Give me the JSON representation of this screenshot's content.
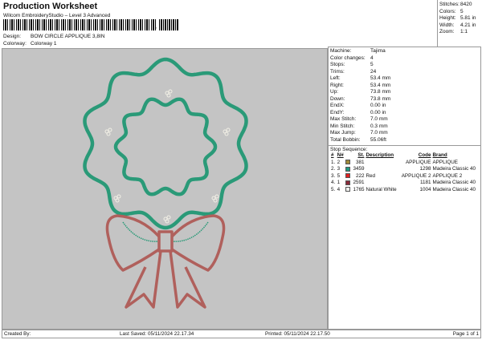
{
  "header": {
    "title": "Production Worksheet",
    "subtitle": "Wilcom EmbroideryStudio – Level 3 Advanced",
    "barcode_suffix": ",",
    "design_label": "Design:",
    "design_value": "BOW CIRCLE APPLIQUE 3,8IN",
    "colorway_label": "Colorway:",
    "colorway_value": "Colorway 1"
  },
  "summary": [
    {
      "k": "Stitches:",
      "v": "8420"
    },
    {
      "k": "Colors:",
      "v": "5"
    },
    {
      "k": "Height:",
      "v": "5.81 in"
    },
    {
      "k": "Width:",
      "v": "4.21 in"
    },
    {
      "k": "Zoom:",
      "v": "1:1"
    }
  ],
  "details": [
    {
      "k": "Machine:",
      "v": "Tajima"
    },
    {
      "k": "Color changes:",
      "v": "4"
    },
    {
      "k": "Stops:",
      "v": "5"
    },
    {
      "k": "Trims:",
      "v": "24"
    },
    {
      "k": "Left:",
      "v": "53.4 mm"
    },
    {
      "k": "Right:",
      "v": "53.4 mm"
    },
    {
      "k": "Up:",
      "v": "73.8 mm"
    },
    {
      "k": "Down:",
      "v": "73.8 mm"
    },
    {
      "k": "EndX:",
      "v": "0.00 in"
    },
    {
      "k": "EndY:",
      "v": "0.00 in"
    },
    {
      "k": "Max Stitch:",
      "v": "7.0 mm"
    },
    {
      "k": "Min Stitch:",
      "v": "0.3 mm"
    },
    {
      "k": "Max Jump:",
      "v": "7.0 mm"
    },
    {
      "k": "Total Bobbin:",
      "v": "55.06ft"
    }
  ],
  "stop_sequence": {
    "title": "Stop Sequence:",
    "headers": [
      "#",
      "N#",
      "St.",
      "Description",
      "Code",
      "Brand"
    ],
    "rows": [
      {
        "n": "1.",
        "num": "2",
        "color": "#a08a3a",
        "st": "381",
        "desc": "",
        "code": "APPLIQUE",
        "brand": "APPLIQUE"
      },
      {
        "n": "2.",
        "num": "3",
        "color": "#1f9a80",
        "st": "3459",
        "desc": "",
        "code": "1298",
        "brand": "Madeira Classic 40"
      },
      {
        "n": "3.",
        "num": "5",
        "color": "#e02020",
        "st": "222",
        "desc": "Red",
        "code": "APPLIQUE 2",
        "brand": "APPLIQUE 2"
      },
      {
        "n": "4.",
        "num": "1",
        "color": "#8a2a3a",
        "st": "2591",
        "desc": "",
        "code": "1181",
        "brand": "Madeira Classic 40"
      },
      {
        "n": "5.",
        "num": "4",
        "color": "#f0f0ee",
        "st": "1765",
        "desc": "Natural White",
        "code": "1004",
        "brand": "Madeira Classic 40"
      }
    ]
  },
  "footer": {
    "created": "Created By:",
    "saved": "Last Saved: 05/11/2024 22.17.34",
    "printed": "Printed: 05/11/2024 22.17.50",
    "page": "Page 1 of 1"
  },
  "colors": {
    "green": "#2a9a78",
    "bow": "#b0605c",
    "canvas": "#c4c4c4"
  }
}
